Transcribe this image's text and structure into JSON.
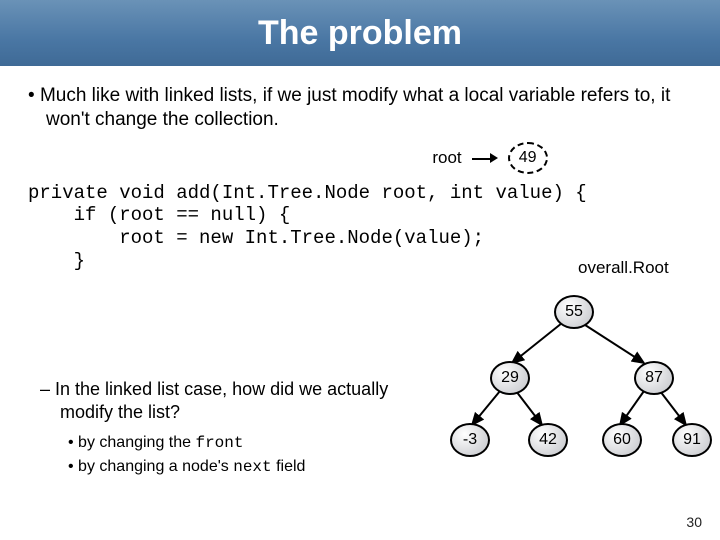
{
  "title": "The problem",
  "bullet_main": "Much like with linked lists, if we just modify what a local variable refers to, it won't change the collection.",
  "root_label": "root",
  "root_node_value": "49",
  "code": "private void add(Int.Tree.Node root, int value) {\n    if (root == null) {\n        root = new Int.Tree.Node(value);\n    }",
  "overall_root_label": "overall.Root",
  "sub_question": "In the linked list case, how did we actually modify the list?",
  "sub_points": {
    "a_prefix": "by changing the ",
    "a_code": "front",
    "b_prefix": "by changing a node's ",
    "b_code": "next",
    "b_suffix": " field"
  },
  "tree": {
    "n55": "55",
    "n29": "29",
    "n87": "87",
    "nm3": "-3",
    "n42": "42",
    "n60": "60",
    "n91": "91"
  },
  "page_number": "30"
}
